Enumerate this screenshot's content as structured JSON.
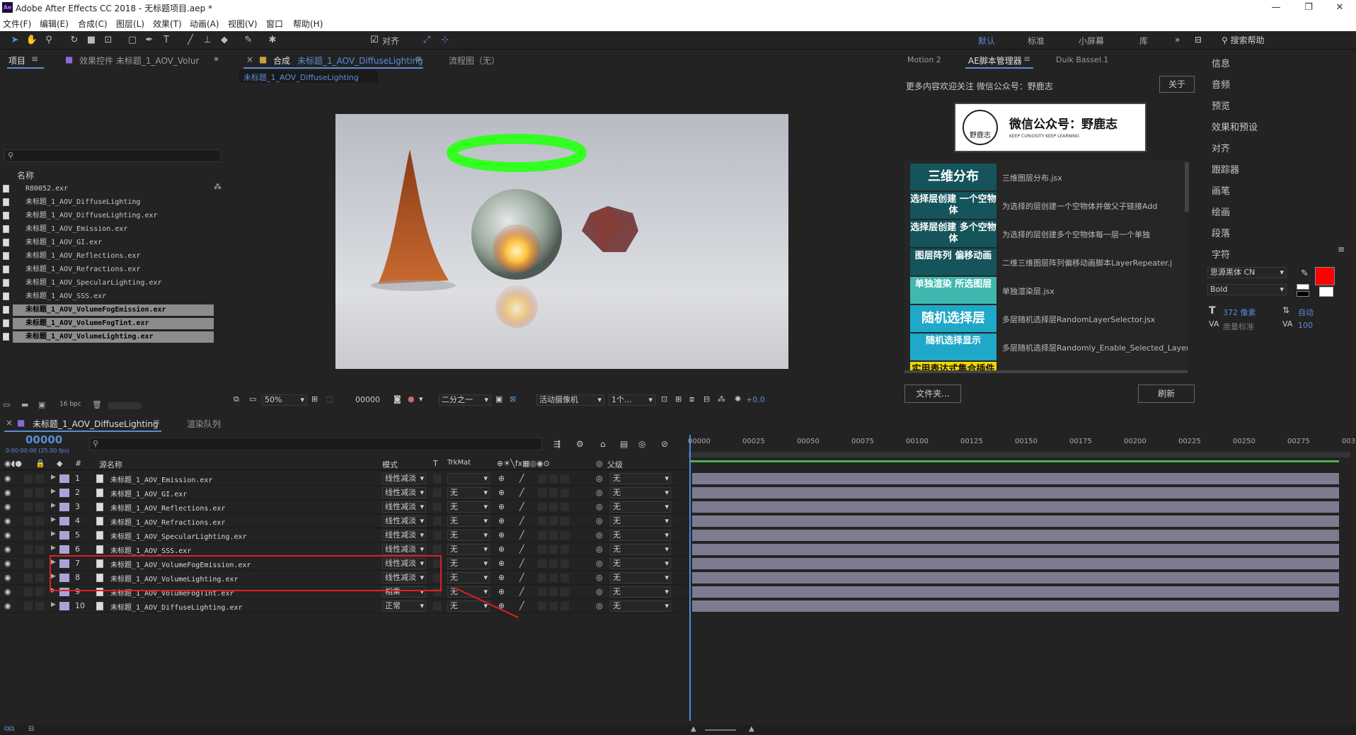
{
  "window": {
    "title": "Adobe After Effects CC 2018 - 无标题项目.aep *",
    "app_icon": "Ae"
  },
  "menu": [
    "文件(F)",
    "编辑(E)",
    "合成(C)",
    "图层(L)",
    "效果(T)",
    "动画(A)",
    "视图(V)",
    "窗口",
    "帮助(H)"
  ],
  "toolbar": {
    "snap_label": "对齐",
    "workspaces": [
      "默认",
      "标准",
      "小屏幕",
      "库"
    ],
    "search_help": "搜索帮助"
  },
  "project_panel": {
    "tab_project": "项目",
    "tab_effects": "效果控件 未标题_1_AOV_Volur",
    "column_name": "名称",
    "bpc": "16 bpc",
    "items": [
      {
        "name": "R80052.exr",
        "selected": false
      },
      {
        "name": "未标题_1_AOV_DiffuseLighting",
        "selected": false
      },
      {
        "name": "未标题_1_AOV_DiffuseLighting.exr",
        "selected": false
      },
      {
        "name": "未标题_1_AOV_Emission.exr",
        "selected": false
      },
      {
        "name": "未标题_1_AOV_GI.exr",
        "selected": false
      },
      {
        "name": "未标题_1_AOV_Reflections.exr",
        "selected": false
      },
      {
        "name": "未标题_1_AOV_Refractions.exr",
        "selected": false
      },
      {
        "name": "未标题_1_AOV_SpecularLighting.exr",
        "selected": false
      },
      {
        "name": "未标题_1_AOV_SSS.exr",
        "selected": false
      },
      {
        "name": "未标题_1_AOV_VolumeFogEmission.exr",
        "selected": true
      },
      {
        "name": "未标题_1_AOV_VolumeFogTint.exr",
        "selected": true
      },
      {
        "name": "未标题_1_AOV_VolumeLighting.exr",
        "selected": true
      }
    ]
  },
  "comp_panel": {
    "tab_prefix": "合成",
    "comp_name": "未标题_1_AOV_DiffuseLighting",
    "flowchart": "流程图（无）",
    "subtab": "未标题_1_AOV_DiffuseLighting",
    "zoom": "50%",
    "timecode": "00000",
    "resolution": "二分之一",
    "camera": "活动摄像机",
    "views": "1个...",
    "exposure": "+0.0"
  },
  "script_panel": {
    "tabs": [
      "Motion 2",
      "AE脚本管理器",
      "Duik Bassel.1"
    ],
    "intro": "更多内容欢迎关注 微信公众号：野鹿志",
    "about": "关于",
    "banner": "微信公众号：野鹿志",
    "banner_small": "KEEP CURIOSITY KEEP LEARNING",
    "banner_logo": "野鹿志",
    "scripts": [
      {
        "button": "三维分布",
        "label": "三维图层分布.jsx",
        "color": "#14545a"
      },
      {
        "button": "选择层创建 一个空物体",
        "label": "为选择的层创建一个空物体并做父子链接Add",
        "color": "#14545a"
      },
      {
        "button": "选择层创建 多个空物体",
        "label": "为选择的层创建多个空物体每一层一个单独",
        "color": "#14545a"
      },
      {
        "button": "图层阵列 偏移动画",
        "label": "二维三维图层阵列偏移动画脚本LayerRepeater.j",
        "color": "#14545a"
      },
      {
        "button": "单独渲染 所选图层",
        "label": "单独渲染层.jsx",
        "color": "#3fb8b0"
      },
      {
        "button": "随机选择层",
        "label": "多层随机选择层RandomLayerSelector.jsx",
        "color": "#1fa8c8"
      },
      {
        "button": "随机选择显示",
        "label": "多层随机选择层Randomly_Enable_Selected_Layer",
        "color": "#1fa8c8"
      },
      {
        "button": "实用表达式集合插件",
        "label": "",
        "color": "#f5d800"
      }
    ],
    "folder": "文件夹...",
    "refresh": "刷新"
  },
  "right_panels": [
    "信息",
    "音频",
    "预览",
    "效果和预设",
    "对齐",
    "跟踪器",
    "画笔",
    "绘画",
    "段落",
    "字符"
  ],
  "character": {
    "font": "思源黑体 CN",
    "style": "Bold",
    "size": "372 像素",
    "leading": "自动",
    "metrics": "度量标准",
    "tracking": "100",
    "fill_color": "#ff0000"
  },
  "timeline": {
    "tab": "未标题_1_AOV_DiffuseLighting",
    "render_queue": "渲染队列",
    "timecode": "00000",
    "fps": "0:00:00:00 (25.00 fps)",
    "headers": {
      "source": "源名称",
      "mode": "模式",
      "t": "T",
      "trkmat": "TrkMat",
      "parent": "父级",
      "num": "#"
    },
    "ruler": [
      "00000",
      "00025",
      "00050",
      "00075",
      "00100",
      "00125",
      "00150",
      "00175",
      "00200",
      "00225",
      "00250",
      "00275",
      "003"
    ],
    "layers": [
      {
        "num": "1",
        "name": "未标题_1_AOV_Emission.exr",
        "mode": "线性减淡",
        "trk": "",
        "parent": "无"
      },
      {
        "num": "2",
        "name": "未标题_1_AOV_GI.exr",
        "mode": "线性减淡",
        "trk": "无",
        "parent": "无"
      },
      {
        "num": "3",
        "name": "未标题_1_AOV_Reflections.exr",
        "mode": "线性减淡",
        "trk": "无",
        "parent": "无"
      },
      {
        "num": "4",
        "name": "未标题_1_AOV_Refractions.exr",
        "mode": "线性减淡",
        "trk": "无",
        "parent": "无"
      },
      {
        "num": "5",
        "name": "未标题_1_AOV_SpecularLighting.exr",
        "mode": "线性减淡",
        "trk": "无",
        "parent": "无"
      },
      {
        "num": "6",
        "name": "未标题_1_AOV_SSS.exr",
        "mode": "线性减淡",
        "trk": "无",
        "parent": "无"
      },
      {
        "num": "7",
        "name": "未标题_1_AOV_VolumeFogEmission.exr",
        "mode": "线性减淡",
        "trk": "无",
        "parent": "无"
      },
      {
        "num": "8",
        "name": "未标题_1_AOV_VolumeLighting.exr",
        "mode": "线性减淡",
        "trk": "无",
        "parent": "无"
      },
      {
        "num": "9",
        "name": "未标题_1_AOV_VolumeFogTint.exr",
        "mode": "相乘",
        "trk": "无",
        "parent": "无"
      },
      {
        "num": "10",
        "name": "未标题_1_AOV_DiffuseLighting.exr",
        "mode": "正常",
        "trk": "无",
        "parent": "无"
      }
    ]
  },
  "colors": {
    "accent": "#5a8dd6",
    "highlight_box": "#e02020",
    "layer_bar": "#7d7b8f"
  }
}
